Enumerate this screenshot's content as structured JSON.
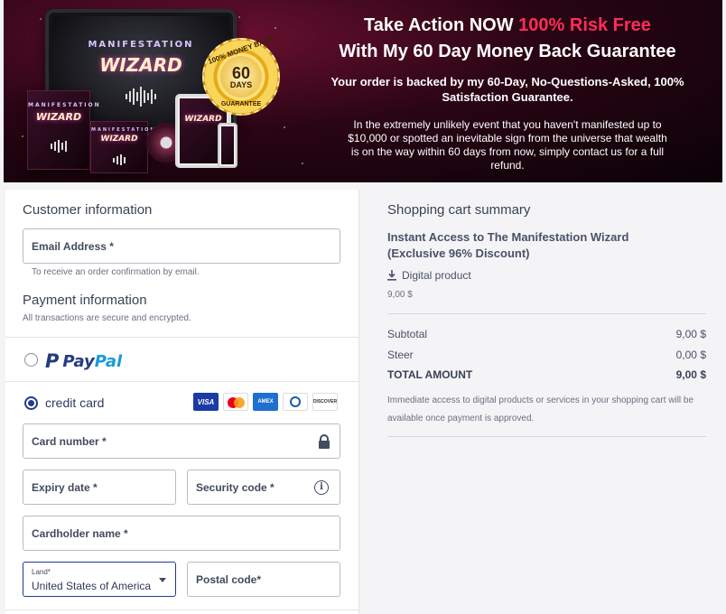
{
  "hero": {
    "headline_part1": "Take Action NOW ",
    "headline_red": "100% Risk Free",
    "headline_line2": "With My 60 Day Money Back Guarantee",
    "subheadline": "Your order is backed by my 60-Day, No-Questions-Asked, 100% Satisfaction Guarantee.",
    "body": "In the extremely unlikely event that you haven't manifested up to $10,000 or spotted an inevitable sign from the universe that wealth is on the way within 60 days from now, simply contact us for a full refund.",
    "product_brand_top": "MANIFESTATION",
    "product_brand_name": "WIZARD",
    "seal_top": "100% MONEY BACK",
    "seal_number": "60",
    "seal_days": "DAYS",
    "seal_bottom": "GUARANTEE",
    "colors": {
      "accent_red": "#ff2d5a",
      "gold": "#e7a91a"
    }
  },
  "customer": {
    "title": "Customer information",
    "email_label": "Email Address *",
    "email_hint": "To receive an order confirmation by email."
  },
  "payment": {
    "title": "Payment information",
    "subtitle": "All transactions are secure and encrypted.",
    "paypal_label_pay": "Pay",
    "paypal_label_pal": "Pal",
    "paypal_selected": false,
    "credit_card_label": "credit card",
    "credit_card_selected": true,
    "card_brands": [
      "VISA",
      "Mastercard",
      "AMEX",
      "Diners Club",
      "DISCOVER"
    ],
    "card_number_label": "Card number *",
    "expiry_label": "Expiry date *",
    "security_label": "Security code *",
    "cardholder_label": "Cardholder name *",
    "country_small_label": "Land*",
    "country_value": "United States of America",
    "postal_label": "Postal code*"
  },
  "summary": {
    "title": "Shopping cart summary",
    "product_name": "Instant Access to The Manifestation Wizard (Exclusive 96% Discount)",
    "product_type": "Digital product",
    "product_price": "9,00 $",
    "subtotal_label": "Subtotal",
    "subtotal_value": "9,00 $",
    "tax_label": "Steer",
    "tax_value": "0,00 $",
    "total_label": "TOTAL AMOUNT",
    "total_value": "9,00 $",
    "note": "Immediate access to digital products or services in your shopping cart will be available once payment is approved."
  }
}
